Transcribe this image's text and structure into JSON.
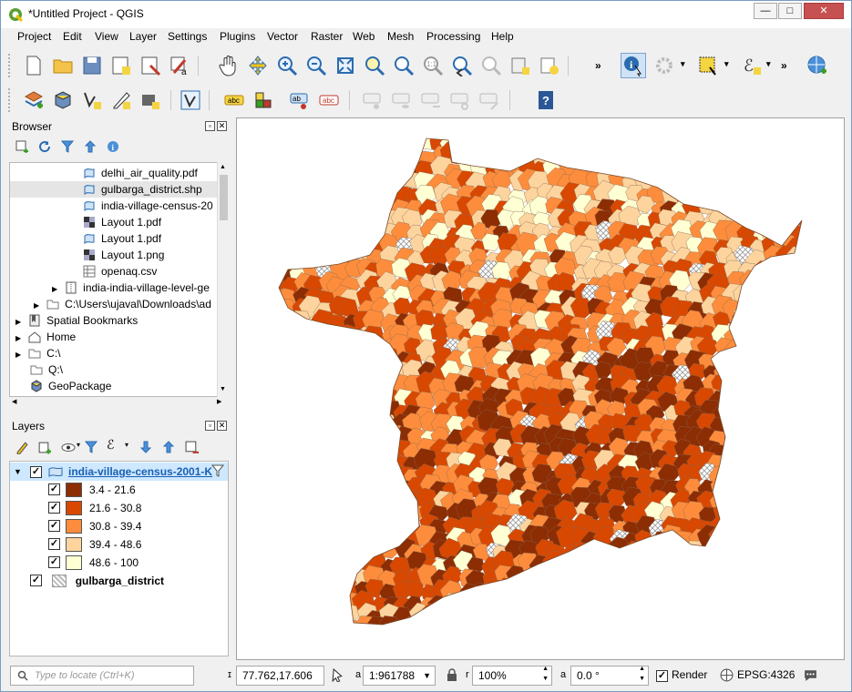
{
  "window": {
    "title": "*Untitled Project - QGIS",
    "minimize": "—",
    "maximize": "□",
    "close": "✕"
  },
  "menus": [
    "Project",
    "Edit",
    "View",
    "Layer",
    "Settings",
    "Plugins",
    "Vector",
    "Raster",
    "Web",
    "Mesh",
    "Processing",
    "Help"
  ],
  "toolbar": {
    "overflow": "»"
  },
  "browser": {
    "title": "Browser",
    "items": [
      {
        "label": "delhi_air_quality.pdf",
        "icon": "vector-file-icon"
      },
      {
        "label": "gulbarga_district.shp",
        "icon": "vector-file-icon"
      },
      {
        "label": "india-village-census-20",
        "icon": "vector-file-icon"
      },
      {
        "label": "Layout 1.pdf",
        "icon": "raster-file-icon"
      },
      {
        "label": "Layout 1.pdf",
        "icon": "vector-file-icon"
      },
      {
        "label": "Layout 1.png",
        "icon": "raster-file-icon"
      },
      {
        "label": "openaq.csv",
        "icon": "table-file-icon"
      },
      {
        "label": "india-india-village-level-ge",
        "icon": "zip-file-icon"
      },
      {
        "label": "C:\\Users\\ujaval\\Downloads\\ad",
        "icon": "folder-icon"
      },
      {
        "label": "Spatial Bookmarks",
        "icon": "bookmark-icon"
      },
      {
        "label": "Home",
        "icon": "home-icon"
      },
      {
        "label": "C:\\",
        "icon": "folder-icon"
      },
      {
        "label": "Q:\\",
        "icon": "folder-icon"
      },
      {
        "label": "GeoPackage",
        "icon": "geopackage-icon"
      }
    ]
  },
  "layers": {
    "title": "Layers",
    "layer1": {
      "name": "india-village-census-2001-K"
    },
    "classes": [
      {
        "label": "3.4 - 21.6",
        "color": "#8c2d04"
      },
      {
        "label": "21.6 - 30.8",
        "color": "#d94801"
      },
      {
        "label": "30.8 - 39.4",
        "color": "#fd8d3c"
      },
      {
        "label": "39.4 - 48.6",
        "color": "#fdd49e"
      },
      {
        "label": "48.6 - 100",
        "color": "#ffffd4"
      }
    ],
    "layer2": {
      "name": "gulbarga_district"
    }
  },
  "status": {
    "locate_placeholder": "Type to locate (Ctrl+K)",
    "coordinate": "77.762,17.606",
    "scale": "1:961788",
    "magnifier": "100%",
    "rotation": "0.0 °",
    "render": "Render",
    "crs": "EPSG:4326"
  }
}
